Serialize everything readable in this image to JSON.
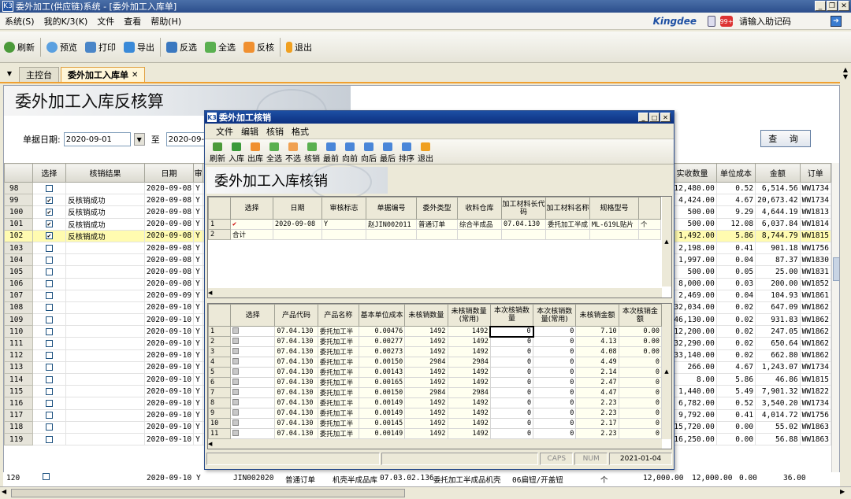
{
  "app": {
    "title": "委外加工(供应链)系统 - [委外加工入库单]",
    "logo": "K3"
  },
  "menu": [
    "系统(S)",
    "我的K/3(K)",
    "文件",
    "查看",
    "帮助(H)"
  ],
  "brand": {
    "name": "Kingdee",
    "helper_placeholder": "请输入助记码"
  },
  "toolbar": [
    "刷新",
    "预览",
    "打印",
    "导出",
    "反选",
    "全选",
    "反核",
    "退出"
  ],
  "tabs": [
    "主控台",
    "委外加工入库单"
  ],
  "page": {
    "title": "委外加工入库反核算",
    "date_label": "单据日期:",
    "date_from": "2020-09-01",
    "to_label": "至",
    "date_to": "2020-09-30",
    "query_label": "查 询"
  },
  "main_grid": {
    "headers": [
      "选择",
      "核销结果",
      "日期",
      "审"
    ],
    "right_headers": [
      "实收数量",
      "单位成本",
      "金额",
      "订单"
    ],
    "rows": [
      {
        "n": "98",
        "chk": false,
        "res": "",
        "date": "2020-09-08",
        "a": "Y",
        "qty": "12,480.00",
        "cost": "0.52",
        "amt": "6,514.56",
        "ord": "WW1734"
      },
      {
        "n": "99",
        "chk": true,
        "res": "反核销成功",
        "date": "2020-09-08",
        "a": "Y",
        "qty": "4,424.00",
        "cost": "4.67",
        "amt": "20,673.42",
        "ord": "WW1734"
      },
      {
        "n": "100",
        "chk": true,
        "res": "反核销成功",
        "date": "2020-09-08",
        "a": "Y",
        "qty": "500.00",
        "cost": "9.29",
        "amt": "4,644.19",
        "ord": "WW1813"
      },
      {
        "n": "101",
        "chk": true,
        "res": "反核销成功",
        "date": "2020-09-08",
        "a": "Y",
        "qty": "500.00",
        "cost": "12.08",
        "amt": "6,037.84",
        "ord": "WW1814"
      },
      {
        "n": "102",
        "chk": true,
        "res": "反核销成功",
        "date": "2020-09-08",
        "a": "Y",
        "qty": "1,492.00",
        "cost": "5.86",
        "amt": "8,744.79",
        "ord": "WW1815",
        "sel": true
      },
      {
        "n": "103",
        "chk": false,
        "res": "",
        "date": "2020-09-08",
        "a": "Y",
        "qty": "2,198.00",
        "cost": "0.41",
        "amt": "901.18",
        "ord": "WW1756"
      },
      {
        "n": "104",
        "chk": false,
        "res": "",
        "date": "2020-09-08",
        "a": "Y",
        "qty": "1,997.00",
        "cost": "0.04",
        "amt": "87.37",
        "ord": "WW1830"
      },
      {
        "n": "105",
        "chk": false,
        "res": "",
        "date": "2020-09-08",
        "a": "Y",
        "qty": "500.00",
        "cost": "0.05",
        "amt": "25.00",
        "ord": "WW1831"
      },
      {
        "n": "106",
        "chk": false,
        "res": "",
        "date": "2020-09-08",
        "a": "Y",
        "qty": "8,000.00",
        "cost": "0.03",
        "amt": "200.00",
        "ord": "WW1852"
      },
      {
        "n": "107",
        "chk": false,
        "res": "",
        "date": "2020-09-09",
        "a": "Y",
        "qty": "2,469.00",
        "cost": "0.04",
        "amt": "104.93",
        "ord": "WW1861"
      },
      {
        "n": "108",
        "chk": false,
        "res": "",
        "date": "2020-09-10",
        "a": "Y",
        "qty": "32,034.00",
        "cost": "0.02",
        "amt": "647.09",
        "ord": "WW1862"
      },
      {
        "n": "109",
        "chk": false,
        "res": "",
        "date": "2020-09-10",
        "a": "Y",
        "qty": "46,130.00",
        "cost": "0.02",
        "amt": "931.83",
        "ord": "WW1862"
      },
      {
        "n": "110",
        "chk": false,
        "res": "",
        "date": "2020-09-10",
        "a": "Y",
        "qty": "12,200.00",
        "cost": "0.02",
        "amt": "247.05",
        "ord": "WW1862"
      },
      {
        "n": "111",
        "chk": false,
        "res": "",
        "date": "2020-09-10",
        "a": "Y",
        "qty": "32,290.00",
        "cost": "0.02",
        "amt": "650.64",
        "ord": "WW1862"
      },
      {
        "n": "112",
        "chk": false,
        "res": "",
        "date": "2020-09-10",
        "a": "Y",
        "qty": "33,140.00",
        "cost": "0.02",
        "amt": "662.80",
        "ord": "WW1862"
      },
      {
        "n": "113",
        "chk": false,
        "res": "",
        "date": "2020-09-10",
        "a": "Y",
        "qty": "266.00",
        "cost": "4.67",
        "amt": "1,243.07",
        "ord": "WW1734"
      },
      {
        "n": "114",
        "chk": false,
        "res": "",
        "date": "2020-09-10",
        "a": "Y",
        "qty": "8.00",
        "cost": "5.86",
        "amt": "46.86",
        "ord": "WW1815"
      },
      {
        "n": "115",
        "chk": false,
        "res": "",
        "date": "2020-09-10",
        "a": "Y",
        "qty": "1,440.00",
        "cost": "5.49",
        "amt": "7,901.32",
        "ord": "WW1822"
      },
      {
        "n": "116",
        "chk": false,
        "res": "",
        "date": "2020-09-10",
        "a": "Y",
        "qty": "6,782.00",
        "cost": "0.52",
        "amt": "3,540.20",
        "ord": "WW1734"
      },
      {
        "n": "117",
        "chk": false,
        "res": "",
        "date": "2020-09-10",
        "a": "Y",
        "qty": "9,792.00",
        "cost": "0.41",
        "amt": "4,014.72",
        "ord": "WW1756"
      },
      {
        "n": "118",
        "chk": false,
        "res": "",
        "date": "2020-09-10",
        "a": "Y",
        "qty": "15,720.00",
        "cost": "0.00",
        "amt": "55.02",
        "ord": "WW1863"
      },
      {
        "n": "119",
        "chk": false,
        "res": "",
        "date": "2020-09-10",
        "a": "Y",
        "qty": "16,250.00",
        "cost": "0.00",
        "amt": "56.88",
        "ord": "WW1863"
      },
      {
        "n": "120",
        "chk": false,
        "res": "",
        "date": "2020-09-10",
        "a": "Y",
        "qty": "12,000.00",
        "cost": "0.00",
        "amt": "36.00",
        "ord": "WW1863"
      }
    ],
    "bottom_row": {
      "billno": "JIN002020",
      "otype": "普通订单",
      "wh": "机壳半成品库",
      "code": "07.03.02.136",
      "name": "委托加工半成品机壳",
      "spec": "06扁钮/开盖钮",
      "unit": "个",
      "qty": "12,000.00",
      "cost": "0.00",
      "amt": "36.00"
    }
  },
  "dialog": {
    "title": "委外加工核销",
    "menu": [
      "文件",
      "编辑",
      "核销",
      "格式"
    ],
    "toolbar": [
      "刷新",
      "入库",
      "出库",
      "全选",
      "不选",
      "核销",
      "最前",
      "向前",
      "向后",
      "最后",
      "排序",
      "退出"
    ],
    "banner": "委外加工入库核销",
    "top_headers": [
      "选择",
      "日期",
      "审核标志",
      "单据编号",
      "委外类型",
      "收料仓库",
      "加工材料长代码",
      "加工材料名称",
      "规格型号"
    ],
    "top_rows": [
      {
        "n": "1",
        "sel": "✔",
        "date": "2020-09-08",
        "flag": "Y",
        "bill": "赵JIN002011",
        "type": "普通订单",
        "wh": "综合半成品",
        "code": "07.04.130",
        "name": "委托加工半成",
        "spec": "ML-619L贴片",
        "unit": "个"
      },
      {
        "n": "2",
        "sel": "合计",
        "date": "",
        "flag": "",
        "bill": "",
        "type": "",
        "wh": "",
        "code": "",
        "name": "",
        "spec": "",
        "unit": ""
      }
    ],
    "bottom_headers": [
      "选择",
      "产品代码",
      "产品名称",
      "基本单位成本",
      "未核销数量",
      "未核销数量(常用)",
      "本次核销数量",
      "本次核销数量(常用)",
      "未核销金额",
      "本次核销金额"
    ],
    "bottom_rows": [
      {
        "n": "1",
        "code": "07.04.130",
        "name": "委托加工半",
        "cost": "0.00476",
        "q1": "1492",
        "q2": "1492",
        "q3": "0",
        "q4": "0",
        "a1": "7.10",
        "a2": "0.00"
      },
      {
        "n": "2",
        "code": "07.04.130",
        "name": "委托加工半",
        "cost": "0.00277",
        "q1": "1492",
        "q2": "1492",
        "q3": "0",
        "q4": "0",
        "a1": "4.13",
        "a2": "0.00"
      },
      {
        "n": "3",
        "code": "07.04.130",
        "name": "委托加工半",
        "cost": "0.00273",
        "q1": "1492",
        "q2": "1492",
        "q3": "0",
        "q4": "0",
        "a1": "4.08",
        "a2": "0.00"
      },
      {
        "n": "4",
        "code": "07.04.130",
        "name": "委托加工半",
        "cost": "0.00150",
        "q1": "2984",
        "q2": "2984",
        "q3": "0",
        "q4": "0",
        "a1": "4.49",
        "a2": "0"
      },
      {
        "n": "5",
        "code": "07.04.130",
        "name": "委托加工半",
        "cost": "0.00143",
        "q1": "1492",
        "q2": "1492",
        "q3": "0",
        "q4": "0",
        "a1": "2.14",
        "a2": "0"
      },
      {
        "n": "6",
        "code": "07.04.130",
        "name": "委托加工半",
        "cost": "0.00165",
        "q1": "1492",
        "q2": "1492",
        "q3": "0",
        "q4": "0",
        "a1": "2.47",
        "a2": "0"
      },
      {
        "n": "7",
        "code": "07.04.130",
        "name": "委托加工半",
        "cost": "0.00150",
        "q1": "2984",
        "q2": "2984",
        "q3": "0",
        "q4": "0",
        "a1": "4.47",
        "a2": "0"
      },
      {
        "n": "8",
        "code": "07.04.130",
        "name": "委托加工半",
        "cost": "0.00149",
        "q1": "1492",
        "q2": "1492",
        "q3": "0",
        "q4": "0",
        "a1": "2.23",
        "a2": "0"
      },
      {
        "n": "9",
        "code": "07.04.130",
        "name": "委托加工半",
        "cost": "0.00149",
        "q1": "1492",
        "q2": "1492",
        "q3": "0",
        "q4": "0",
        "a1": "2.23",
        "a2": "0"
      },
      {
        "n": "10",
        "code": "07.04.130",
        "name": "委托加工半",
        "cost": "0.00145",
        "q1": "1492",
        "q2": "1492",
        "q3": "0",
        "q4": "0",
        "a1": "2.17",
        "a2": "0"
      },
      {
        "n": "11",
        "code": "07.04.130",
        "name": "委托加工半",
        "cost": "0.00149",
        "q1": "1492",
        "q2": "1492",
        "q3": "0",
        "q4": "0",
        "a1": "2.23",
        "a2": "0"
      },
      {
        "n": "12",
        "code": "07.04.130",
        "name": "委托加工半",
        "cost": "0.00150",
        "q1": "2984",
        "q2": "2984",
        "q3": "0",
        "q4": "0",
        "a1": "4.47",
        "a2": "0"
      }
    ],
    "status": {
      "caps": "CAPS",
      "num": "NUM",
      "date": "2021-01-04"
    }
  }
}
